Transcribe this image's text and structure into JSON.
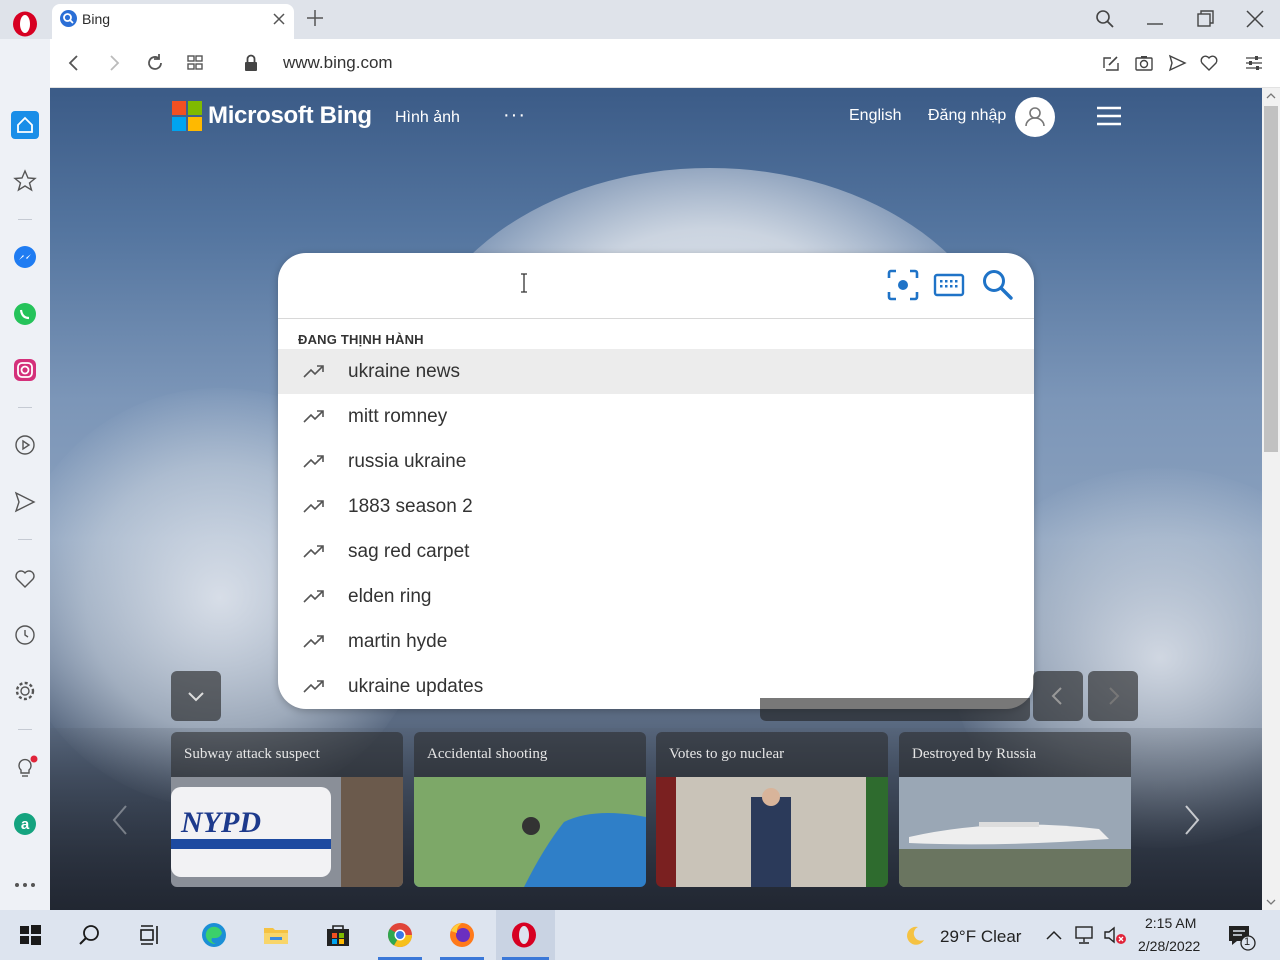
{
  "browser": {
    "tab_title": "Bing",
    "url": "www.bing.com"
  },
  "bing": {
    "brand": "Microsoft Bing",
    "nav_images": "Hình ảnh",
    "nav_more": "···",
    "lang": "English",
    "sign_in": "Đăng nhập"
  },
  "search": {
    "value": "",
    "trending_title": "ĐANG THỊNH HÀNH",
    "suggestions": [
      "ukraine news",
      "mitt romney",
      "russia ukraine",
      "1883 season 2",
      "sag red carpet",
      "elden ring",
      "martin hyde",
      "ukraine updates"
    ]
  },
  "news_cards": [
    {
      "title": "Subway attack suspect"
    },
    {
      "title": "Accidental shooting"
    },
    {
      "title": "Votes to go nuclear"
    },
    {
      "title": "Destroyed by Russia"
    }
  ],
  "taskbar": {
    "weather": "29°F  Clear",
    "time": "2:15 AM",
    "date": "2/28/2022",
    "notification_count": "1"
  },
  "colors": {
    "opera_red": "#d70022",
    "bing_blue": "#1f73c7",
    "sidebar_bg": "#eef1f6",
    "taskbar_bg": "#dde4ef"
  }
}
